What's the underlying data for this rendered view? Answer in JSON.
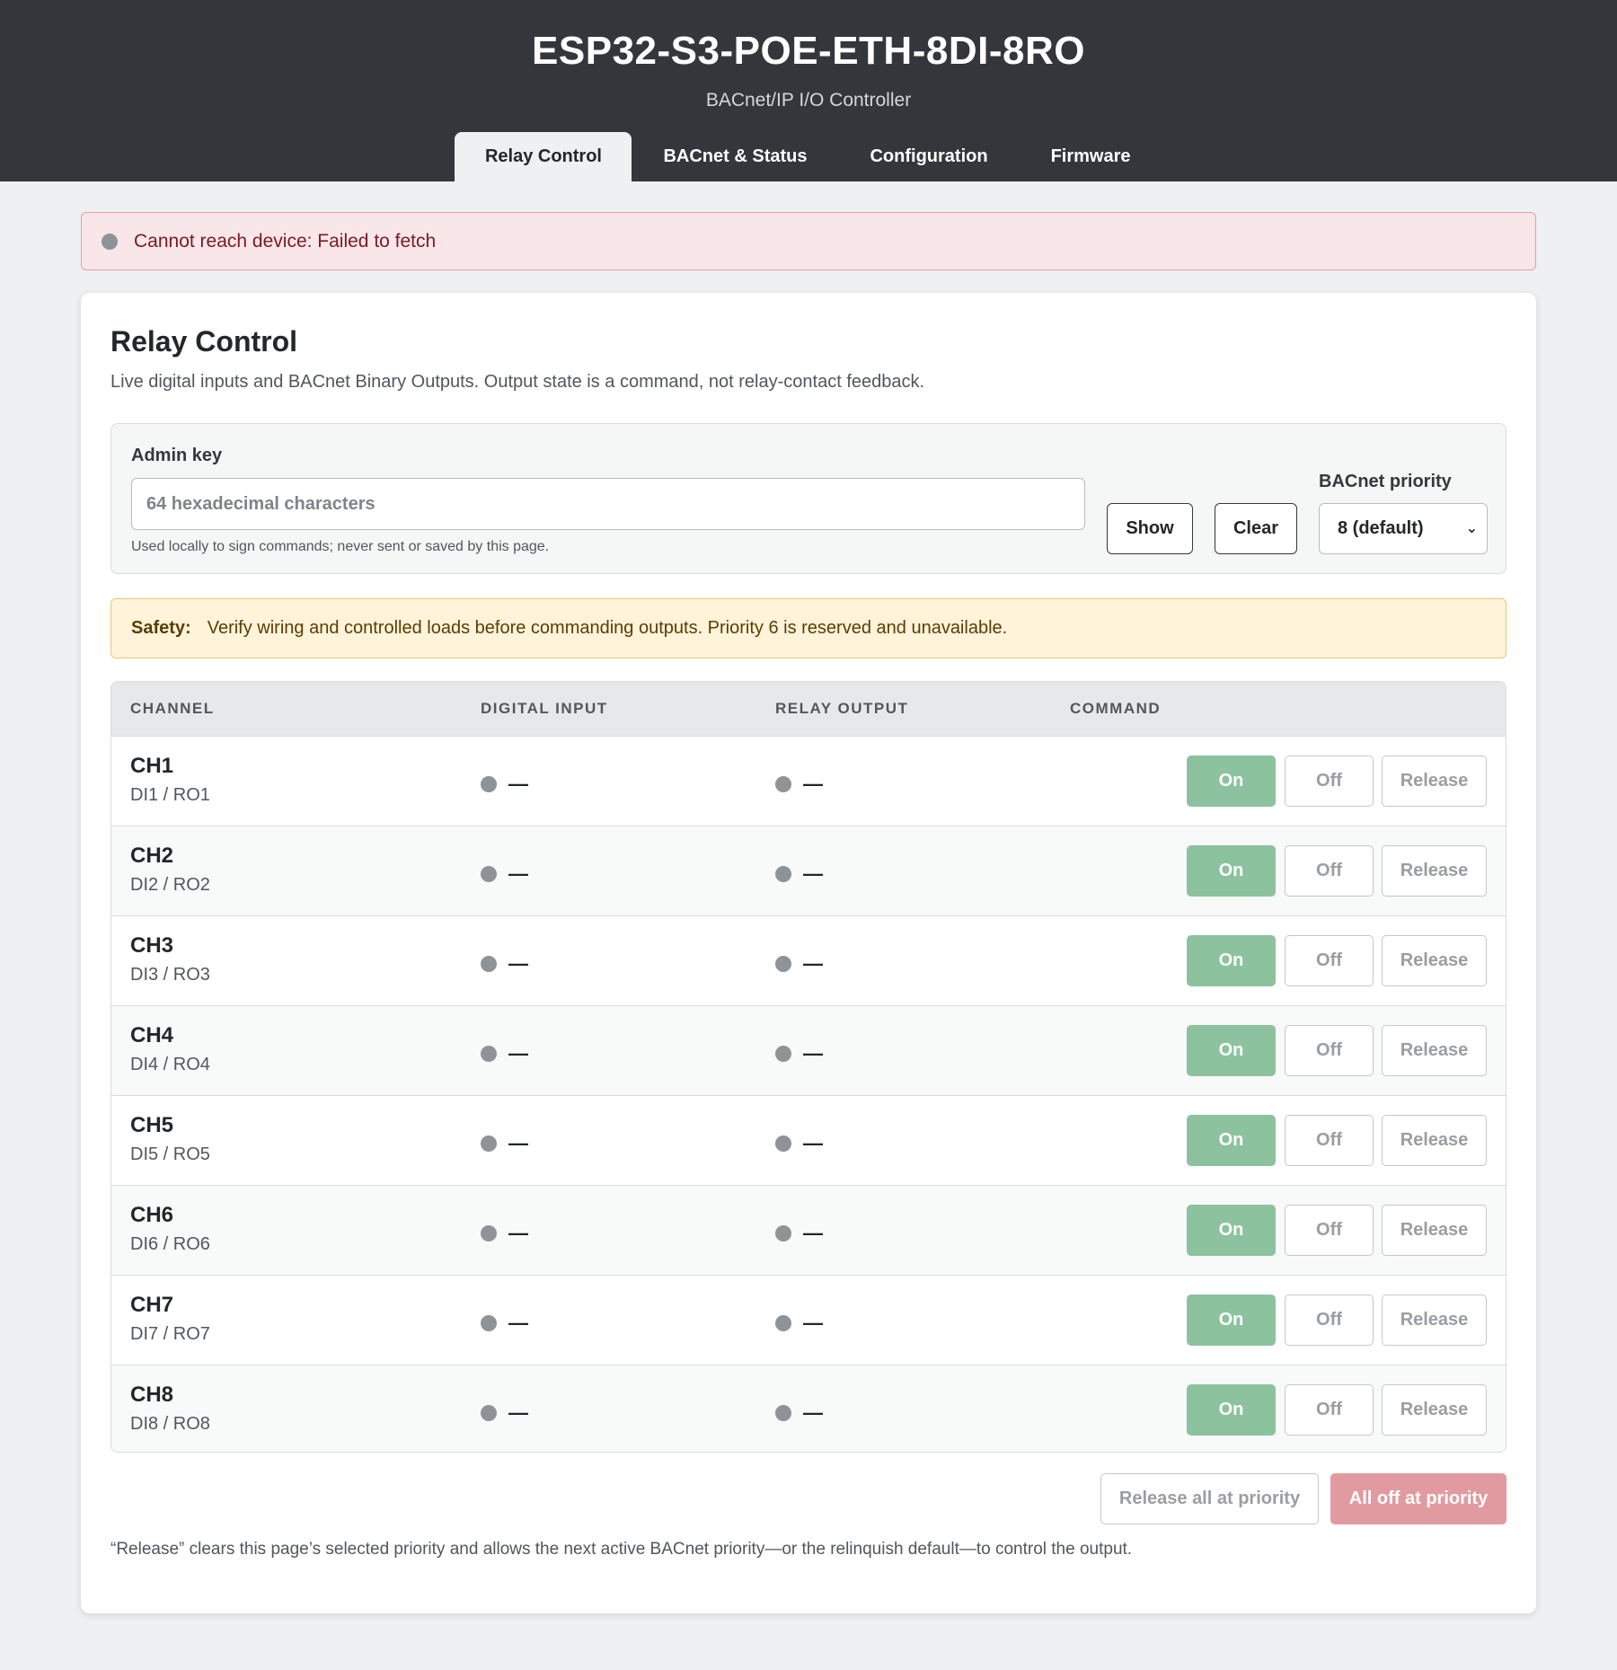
{
  "header": {
    "title": "ESP32-S3-POE-ETH-8DI-8RO",
    "subtitle": "BACnet/IP I/O Controller",
    "tabs": [
      {
        "label": "Relay Control",
        "active": true
      },
      {
        "label": "BACnet & Status",
        "active": false
      },
      {
        "label": "Configuration",
        "active": false
      },
      {
        "label": "Firmware",
        "active": false
      }
    ]
  },
  "alert": {
    "message": "Cannot reach device: Failed to fetch"
  },
  "card": {
    "title": "Relay Control",
    "description": "Live digital inputs and BACnet Binary Outputs. Output state is a command, not relay-contact feedback."
  },
  "admin": {
    "label": "Admin key",
    "placeholder": "64 hexadecimal characters",
    "value": "",
    "help": "Used locally to sign commands; never sent or saved by this page.",
    "show_label": "Show",
    "clear_label": "Clear",
    "priority_label": "BACnet priority",
    "priority_value": "8 (default)"
  },
  "safety": {
    "label": "Safety:",
    "text": "Verify wiring and controlled loads before commanding outputs. Priority 6 is reserved and unavailable."
  },
  "table": {
    "headers": [
      "CHANNEL",
      "DIGITAL INPUT",
      "RELAY OUTPUT",
      "COMMAND"
    ],
    "rows": [
      {
        "channel": "CH1",
        "io": "DI1 / RO1",
        "di": "—",
        "ro": "—",
        "on": "On",
        "off": "Off",
        "release": "Release"
      },
      {
        "channel": "CH2",
        "io": "DI2 / RO2",
        "di": "—",
        "ro": "—",
        "on": "On",
        "off": "Off",
        "release": "Release"
      },
      {
        "channel": "CH3",
        "io": "DI3 / RO3",
        "di": "—",
        "ro": "—",
        "on": "On",
        "off": "Off",
        "release": "Release"
      },
      {
        "channel": "CH4",
        "io": "DI4 / RO4",
        "di": "—",
        "ro": "—",
        "on": "On",
        "off": "Off",
        "release": "Release"
      },
      {
        "channel": "CH5",
        "io": "DI5 / RO5",
        "di": "—",
        "ro": "—",
        "on": "On",
        "off": "Off",
        "release": "Release"
      },
      {
        "channel": "CH6",
        "io": "DI6 / RO6",
        "di": "—",
        "ro": "—",
        "on": "On",
        "off": "Off",
        "release": "Release"
      },
      {
        "channel": "CH7",
        "io": "DI7 / RO7",
        "di": "—",
        "ro": "—",
        "on": "On",
        "off": "Off",
        "release": "Release"
      },
      {
        "channel": "CH8",
        "io": "DI8 / RO8",
        "di": "—",
        "ro": "—",
        "on": "On",
        "off": "Off",
        "release": "Release"
      }
    ]
  },
  "actions": {
    "release_all_label": "Release all at priority",
    "all_off_label": "All off at priority"
  },
  "footnote": "“Release” clears this page’s selected priority and allows the next active BACnet priority—or the relinquish default—to control the output.",
  "colors": {
    "header_bg": "#33373b",
    "alert_bg": "#f9e6e8",
    "safety_bg": "#fff3da",
    "on_button": "#8dc29f",
    "all_off_button": "#e29aa1",
    "status_dot": "#8e9398"
  }
}
